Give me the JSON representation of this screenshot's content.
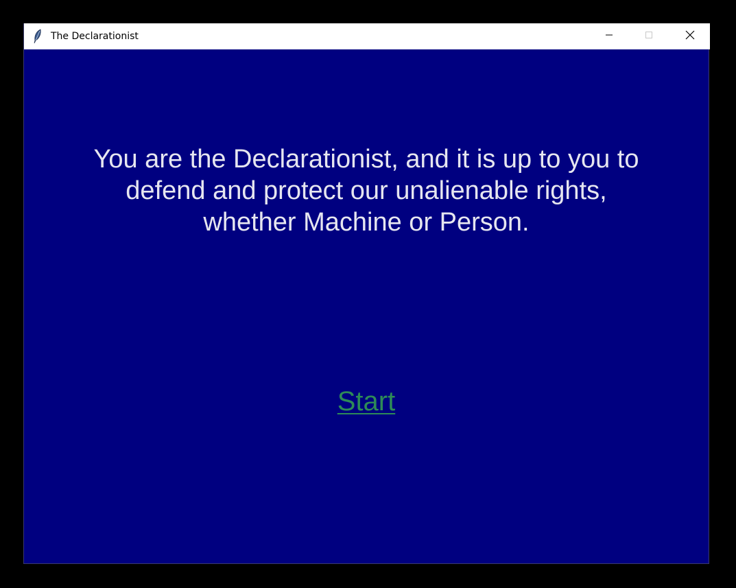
{
  "window": {
    "title": "The Declarationist",
    "icon": "feather-icon",
    "controls": {
      "minimize": "minimize-icon",
      "maximize": "maximize-icon",
      "close": "close-icon"
    }
  },
  "main": {
    "intro_text": "You are the Declarationist, and it is up to you to\ndefend and protect our unalienable rights,\nwhether Machine or Person.",
    "start_label": "Start"
  },
  "colors": {
    "background": "#000080",
    "text": "#e6e6f0",
    "start_link": "#2e8b57",
    "titlebar": "#ffffff"
  }
}
